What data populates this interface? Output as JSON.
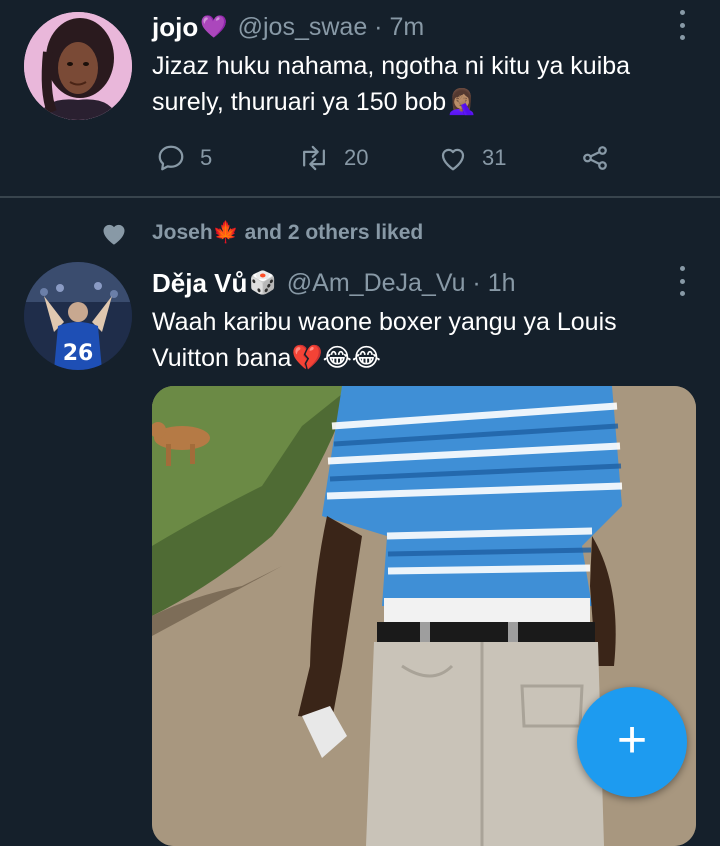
{
  "tweets": [
    {
      "name": "jojo",
      "name_emoji": "💜",
      "handle_time": "@jos_swae · 7m",
      "text_line1": "Jizaz huku nahama, ngotha ni kitu ya kuiba",
      "text_line2": "surely, thuruari ya 150 bob🤦🏽‍♀️",
      "replies": "5",
      "retweets": "20",
      "likes": "31"
    },
    {
      "social_context": "Joseh🍁 and 2 others liked",
      "name": "Dějа Vů",
      "name_emoji": "🎲",
      "handle_time": "@Am_DeJa_Vu · 1h",
      "text_line1": "Waah karibu waone boxer yangu ya Louis",
      "text_line2": "Vuitton bana💔😂😂",
      "jersey_number": "26"
    }
  ],
  "fab_label": "+",
  "colors": {
    "background": "#15202b",
    "secondary_text": "#8899a6",
    "divider": "#38444d",
    "accent": "#1d9bf0"
  },
  "icons": [
    "reply-icon",
    "retweet-icon",
    "like-icon",
    "share-icon",
    "heart-filled-icon",
    "more-icon",
    "plus-icon"
  ]
}
